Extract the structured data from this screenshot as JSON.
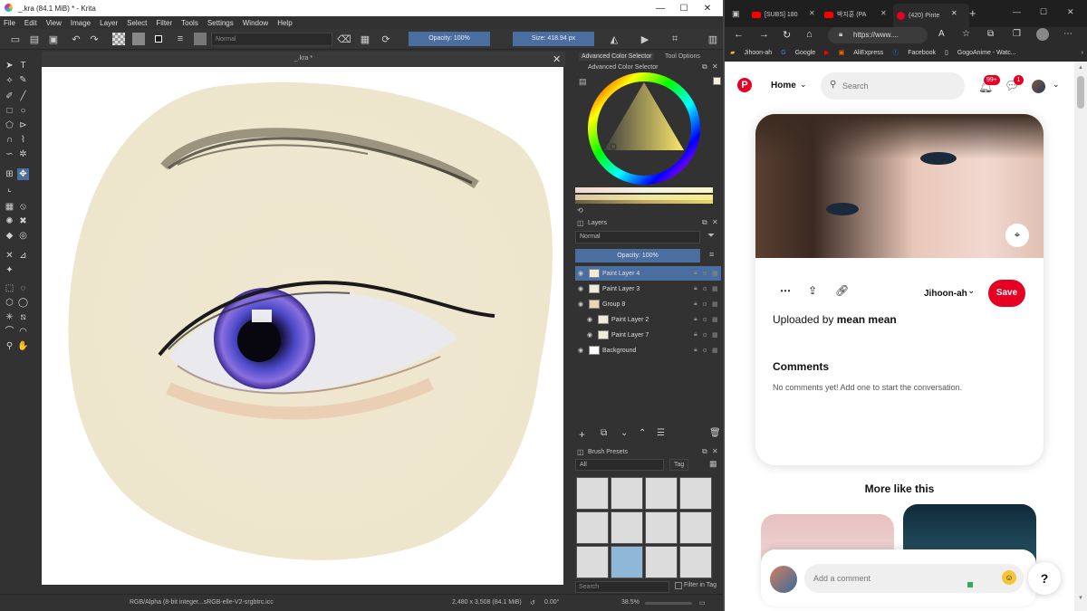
{
  "krita": {
    "title": "_.kra (84.1 MiB)  * - Krita",
    "menu": [
      "File",
      "Edit",
      "View",
      "Image",
      "Layer",
      "Select",
      "Filter",
      "Tools",
      "Settings",
      "Window",
      "Help"
    ],
    "blend_mode": "Normal",
    "opacity": "Opacity: 100%",
    "size": "Size: 418.94 px",
    "doc_tab": "_.kra *",
    "advanced_color_tab": "Advanced Color Selector",
    "tool_options_tab": "Tool Options",
    "advanced_color_header": "Advanced Color Selector",
    "layers_header": "Layers",
    "layers_blend": "Normal",
    "layers_opacity": "Opacity:  100%",
    "layers": [
      {
        "name": "Paint Layer 4",
        "selected": true
      },
      {
        "name": "Paint Layer 3"
      },
      {
        "name": "Group 8"
      },
      {
        "name": "Paint Layer 2"
      },
      {
        "name": "Paint Layer 7"
      },
      {
        "name": "Background"
      }
    ],
    "brush_presets_header": "Brush Presets",
    "brush_filter": "All",
    "brush_tag": "Tag",
    "search_placeholder": "Search",
    "filter_in_tag": "Filter in Tag",
    "status": {
      "color_space": "RGB/Alpha (8-bit integer...sRGB-elle-V2-srgbtrc.icc",
      "dims": "2,480 x 3,508 (84.1 MiB)",
      "rotation": "0.00°",
      "zoom": "38.5%"
    }
  },
  "browser": {
    "tabs": [
      "[SUBS] 180",
      "박지훈 (PA",
      "(420) Pinte"
    ],
    "url": "https://www....",
    "bookmarks": [
      "Jihoon-ah",
      "Google",
      "AliExpress",
      "Facebook",
      "GogoAnime - Watc..."
    ],
    "pinterest": {
      "home": "Home",
      "search_placeholder": "Search",
      "notif_badge": "99+",
      "msg_badge": "1",
      "board": "Jihoon-ah",
      "save": "Save",
      "uploaded_prefix": "Uploaded by ",
      "uploader": "mean mean",
      "comments_title": "Comments",
      "no_comments": "No comments yet! Add one to start the conversation.",
      "more_like_this": "More like this",
      "add_comment": "Add a comment",
      "help": "?"
    }
  },
  "colors": {
    "pinterest_red": "#e60023",
    "krita_accent": "#4a6ea0"
  }
}
